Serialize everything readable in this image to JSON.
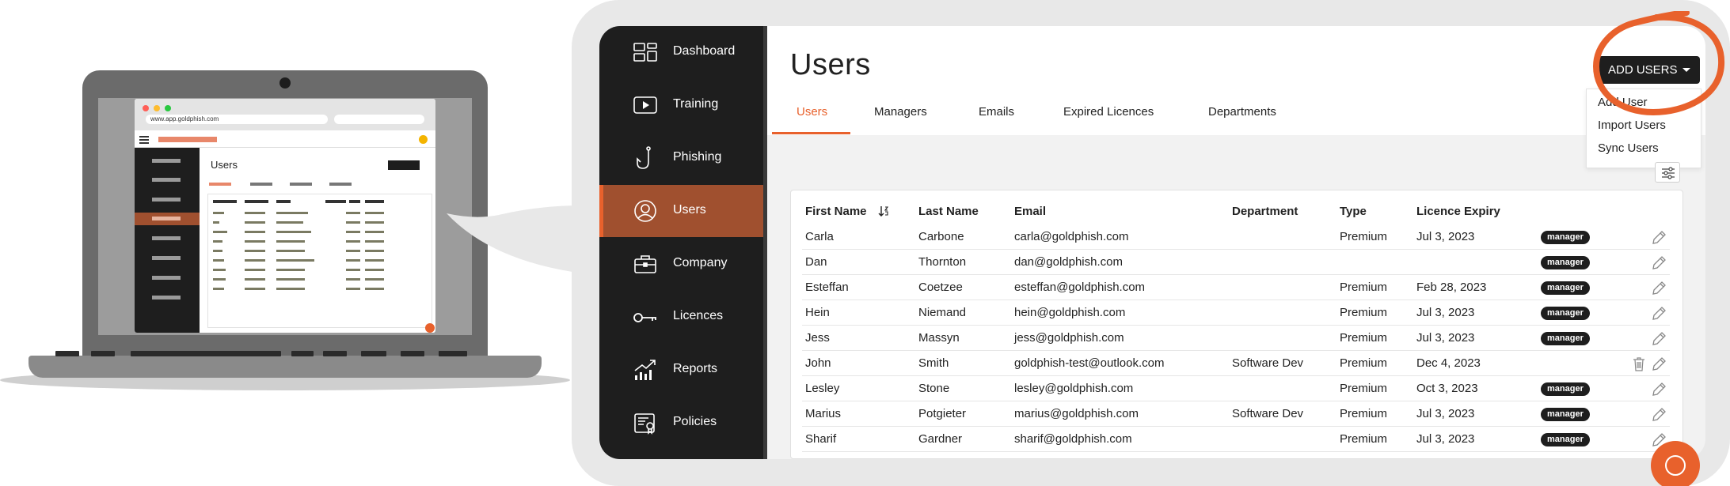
{
  "illustration": {
    "url": "www.app.goldphish.com",
    "mini_title": "Users"
  },
  "sidebar": {
    "items": [
      {
        "label": "Dashboard",
        "icon": "dashboard-icon"
      },
      {
        "label": "Training",
        "icon": "play-icon"
      },
      {
        "label": "Phishing",
        "icon": "fish-hook-icon"
      },
      {
        "label": "Users",
        "icon": "user-icon",
        "active": true
      },
      {
        "label": "Company",
        "icon": "briefcase-icon"
      },
      {
        "label": "Licences",
        "icon": "key-icon"
      },
      {
        "label": "Reports",
        "icon": "chart-up-icon"
      },
      {
        "label": "Policies",
        "icon": "policy-icon"
      }
    ]
  },
  "header": {
    "title": "Users",
    "tabs": [
      {
        "label": "Users",
        "active": true
      },
      {
        "label": "Managers"
      },
      {
        "label": "Emails"
      },
      {
        "label": "Expired Licences"
      },
      {
        "label": "Departments"
      }
    ]
  },
  "add_users": {
    "label": "ADD USERS",
    "menu": [
      "Add User",
      "Import Users",
      "Sync Users"
    ]
  },
  "table": {
    "columns": [
      "First Name",
      "Last Name",
      "Email",
      "Department",
      "Type",
      "Licence Expiry"
    ],
    "rows": [
      {
        "first": "Carla",
        "last": "Carbone",
        "email": "carla@goldphish.com",
        "department": "",
        "type": "Premium",
        "expiry": "Jul 3, 2023",
        "badge": "manager",
        "trash": false
      },
      {
        "first": "Dan",
        "last": "Thornton",
        "email": "dan@goldphish.com",
        "department": "",
        "type": "",
        "expiry": "",
        "badge": "manager",
        "trash": false
      },
      {
        "first": "Esteffan",
        "last": "Coetzee",
        "email": "esteffan@goldphish.com",
        "department": "",
        "type": "Premium",
        "expiry": "Feb 28, 2023",
        "badge": "manager",
        "trash": false
      },
      {
        "first": "Hein",
        "last": "Niemand",
        "email": "hein@goldphish.com",
        "department": "",
        "type": "Premium",
        "expiry": "Jul 3, 2023",
        "badge": "manager",
        "trash": false
      },
      {
        "first": "Jess",
        "last": "Massyn",
        "email": "jess@goldphish.com",
        "department": "",
        "type": "Premium",
        "expiry": "Jul 3, 2023",
        "badge": "manager",
        "trash": false
      },
      {
        "first": "John",
        "last": "Smith",
        "email": "goldphish-test@outlook.com",
        "department": "Software Dev",
        "type": "Premium",
        "expiry": "Dec 4, 2023",
        "badge": "",
        "trash": true
      },
      {
        "first": "Lesley",
        "last": "Stone",
        "email": "lesley@goldphish.com",
        "department": "",
        "type": "Premium",
        "expiry": "Oct 3, 2023",
        "badge": "manager",
        "trash": false
      },
      {
        "first": "Marius",
        "last": "Potgieter",
        "email": "marius@goldphish.com",
        "department": "Software Dev",
        "type": "Premium",
        "expiry": "Jul 3, 2023",
        "badge": "manager",
        "trash": false
      },
      {
        "first": "Sharif",
        "last": "Gardner",
        "email": "sharif@goldphish.com",
        "department": "",
        "type": "Premium",
        "expiry": "Jul 3, 2023",
        "badge": "manager",
        "trash": false
      }
    ]
  },
  "colors": {
    "accent": "#e8612c",
    "sidebar_bg": "#1e1e1e",
    "sidebar_active": "#a0502f",
    "badge_bg": "#1e1e1e"
  }
}
